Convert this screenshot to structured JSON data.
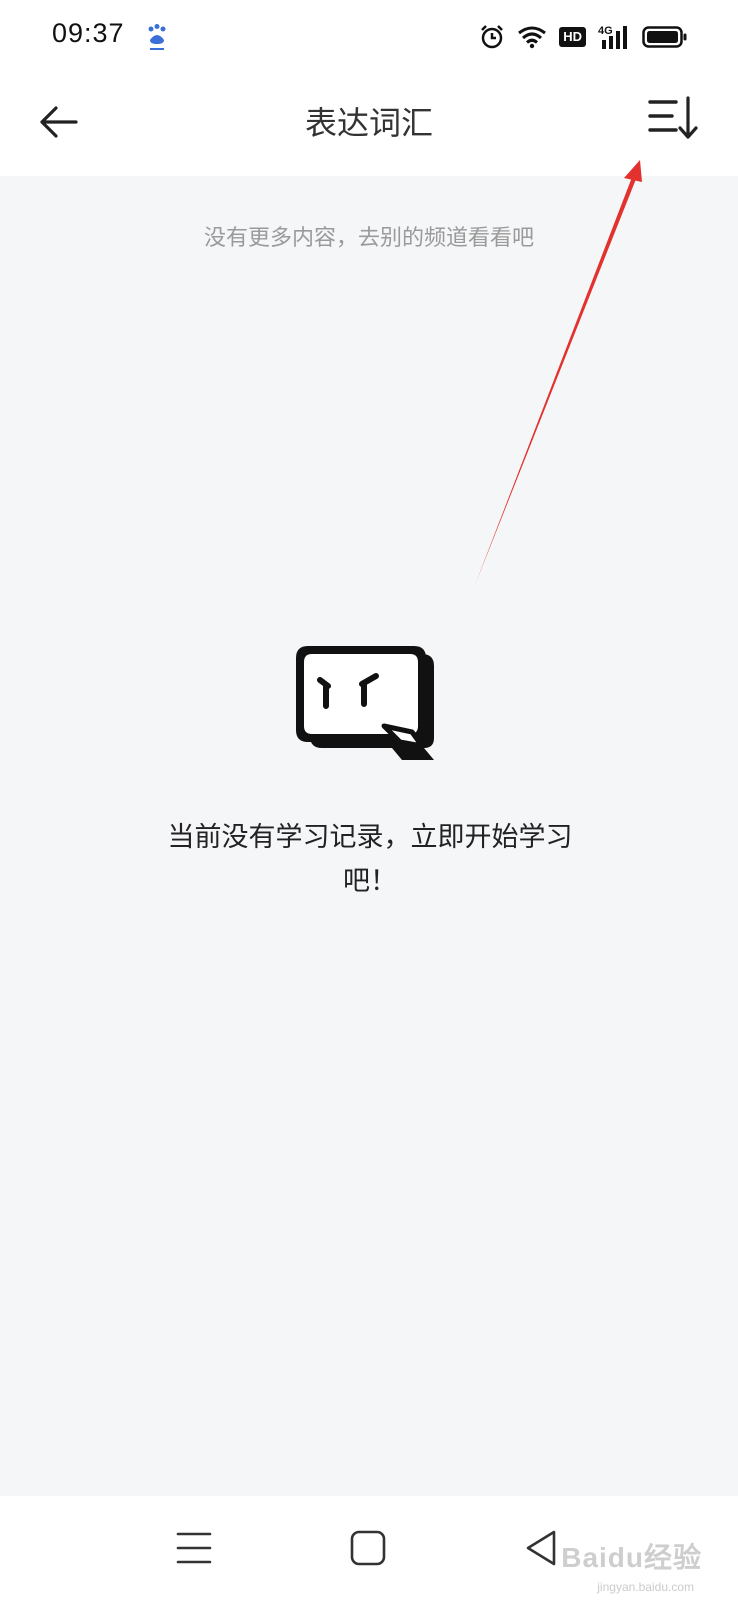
{
  "status_bar": {
    "time": "09:37",
    "app_icon": "baidu-paw-icon",
    "icons": [
      "alarm-icon",
      "wifi-icon",
      "hd-badge",
      "signal-4g-icon",
      "battery-icon"
    ],
    "hd_label": "HD",
    "network_label": "4G"
  },
  "header": {
    "back_icon": "arrow-left-icon",
    "title": "表达词汇",
    "sort_icon": "sort-list-icon"
  },
  "content": {
    "no_more_text": "没有更多内容，去别的频道看看吧",
    "empty_illustration_icon": "empty-chat-face-icon",
    "empty_message": "当前没有学习记录，立即开始学习吧！"
  },
  "annotation": {
    "arrow_color": "#e3312d"
  },
  "nav_bar": {
    "icons": [
      "menu-icon",
      "home-square-icon",
      "back-triangle-icon"
    ]
  },
  "watermark": {
    "brand": "Baidu经验",
    "url": "jingyan.baidu.com"
  },
  "colors": {
    "background": "#f5f6f8",
    "surface": "#ffffff",
    "text_primary": "#222222",
    "text_secondary": "#9a9a9a"
  }
}
